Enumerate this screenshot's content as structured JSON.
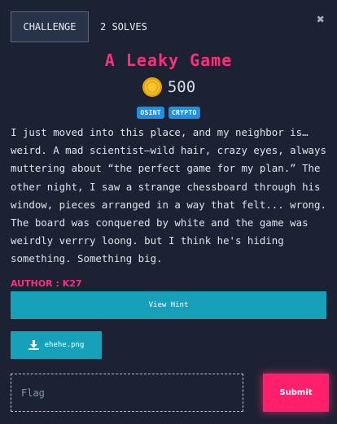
{
  "tabs": {
    "challenge": "CHALLENGE",
    "solves": "2 SOLVES"
  },
  "close_icon": "close-icon",
  "challenge": {
    "title": "A Leaky Game",
    "points": "500",
    "tags": [
      "OSINT",
      "CRYPTO"
    ],
    "description": "I just moved into this place, and my neighbor is…\nweird. A mad scientist—wild hair, crazy eyes, always\nmuttering about “the perfect game for my plan.” The\nother night, I saw a strange chessboard through his\nwindow, pieces arranged in a way that felt... wrong.\nThe board was conquered by white and the game was\nweirdly verrry loong. but I think he's hiding\nsomething. Something big.",
    "author": "AUTHOR : K27"
  },
  "buttons": {
    "view_hint": "View Hint",
    "file": "ehehe.png",
    "submit": "Submit"
  },
  "flag_input": {
    "placeholder": "Flag",
    "value": ""
  },
  "colors": {
    "accent_pink": "#ff2e7a",
    "teal": "#17a0b9",
    "tag_blue": "#1e8fe6",
    "background": "#1b2233"
  }
}
